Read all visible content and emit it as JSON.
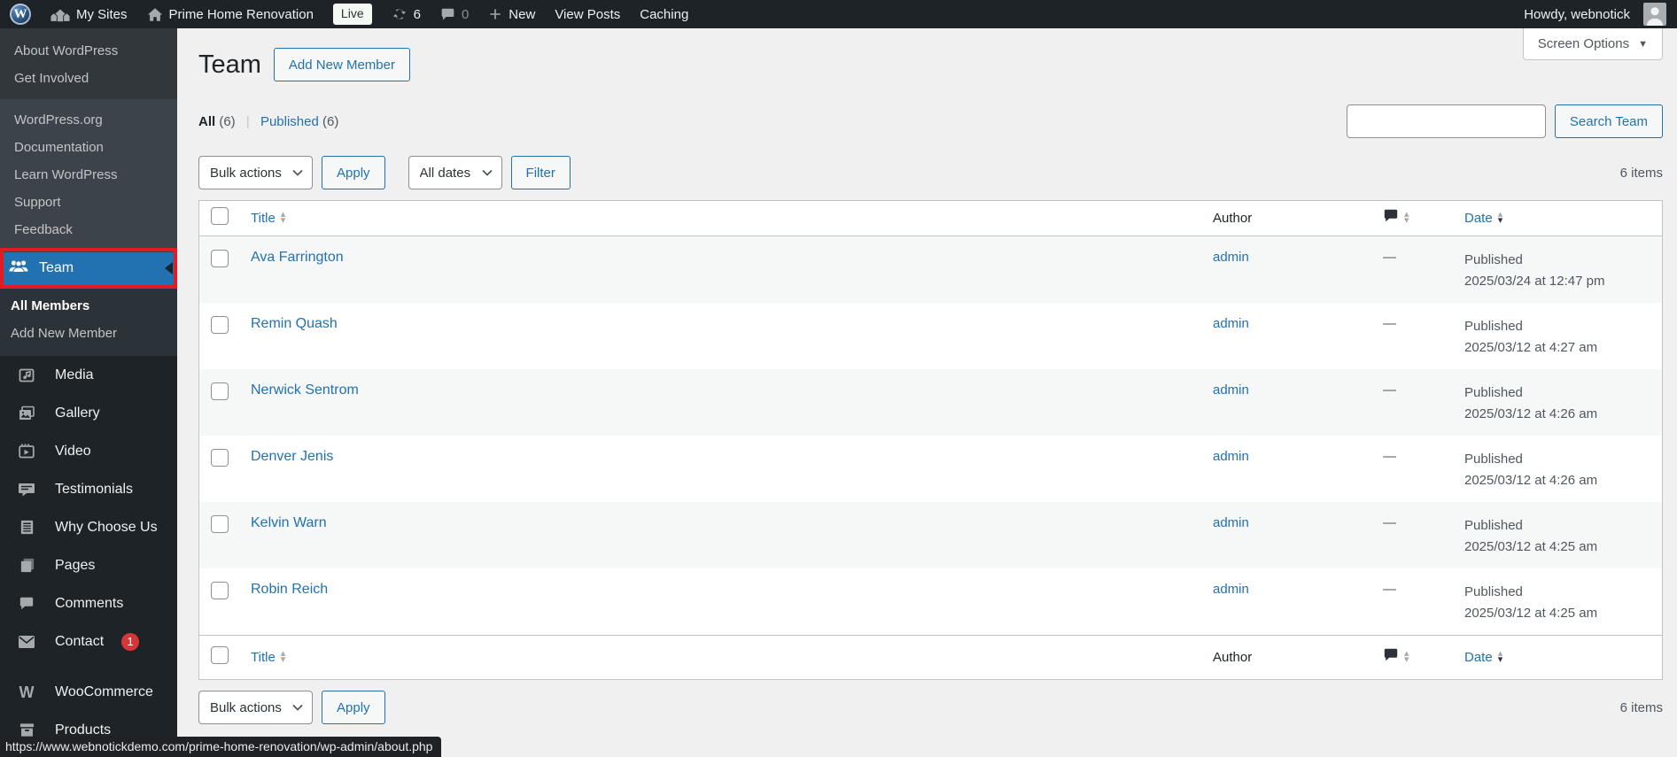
{
  "admin_bar": {
    "my_sites_label": "My Sites",
    "site_name": "Prime Home Renovation",
    "live_badge": "Live",
    "update_count": "6",
    "comment_count": "0",
    "new_label": "New",
    "view_posts_label": "View Posts",
    "caching_label": "Caching",
    "howdy_label": "Howdy, webnotick"
  },
  "wp_logo_menu": {
    "secondary": [
      "About WordPress",
      "Get Involved"
    ],
    "links": [
      "WordPress.org",
      "Documentation",
      "Learn WordPress",
      "Support",
      "Feedback"
    ]
  },
  "sidebar": {
    "team_label": "Team",
    "team_submenu": [
      "All Members",
      "Add New Member"
    ],
    "menu": [
      {
        "label": "Media"
      },
      {
        "label": "Gallery"
      },
      {
        "label": "Video"
      },
      {
        "label": "Testimonials"
      },
      {
        "label": "Why Choose Us"
      },
      {
        "label": "Pages"
      },
      {
        "label": "Comments"
      },
      {
        "label": "Contact",
        "badge": "1"
      },
      {
        "label": "WooCommerce"
      },
      {
        "label": "Products"
      }
    ]
  },
  "page": {
    "title": "Team",
    "add_new_label": "Add New Member",
    "screen_options_label": "Screen Options",
    "views": {
      "all_label": "All",
      "all_count": "(6)",
      "separator": "|",
      "published_label": "Published",
      "published_count": "(6)"
    },
    "search_value": "",
    "search_button_label": "Search Team",
    "bulk_actions_label": "Bulk actions",
    "apply_label": "Apply",
    "all_dates_label": "All dates",
    "filter_label": "Filter",
    "items_count": "6 items"
  },
  "table": {
    "headers": {
      "title": "Title",
      "author": "Author",
      "date": "Date"
    },
    "rows": [
      {
        "title": "Ava Farrington",
        "author": "admin",
        "comments": "—",
        "status": "Published",
        "date": "2025/03/24 at 12:47 pm"
      },
      {
        "title": "Remin Quash",
        "author": "admin",
        "comments": "—",
        "status": "Published",
        "date": "2025/03/12 at 4:27 am"
      },
      {
        "title": "Nerwick Sentrom",
        "author": "admin",
        "comments": "—",
        "status": "Published",
        "date": "2025/03/12 at 4:26 am"
      },
      {
        "title": "Denver Jenis",
        "author": "admin",
        "comments": "—",
        "status": "Published",
        "date": "2025/03/12 at 4:26 am"
      },
      {
        "title": "Kelvin Warn",
        "author": "admin",
        "comments": "—",
        "status": "Published",
        "date": "2025/03/12 at 4:25 am"
      },
      {
        "title": "Robin Reich",
        "author": "admin",
        "comments": "—",
        "status": "Published",
        "date": "2025/03/12 at 4:25 am"
      }
    ]
  },
  "status_bar": {
    "url": "https://www.webnotickdemo.com/prime-home-renovation/wp-admin/about.php"
  },
  "colors": {
    "accent": "#2271b1",
    "highlight_border": "#e01b24",
    "notification_badge": "#d63638",
    "live_badge_bg": "#f4faf1",
    "admin_bar_bg": "#1d2327",
    "stripe_row_bg": "#f6f7f7"
  }
}
